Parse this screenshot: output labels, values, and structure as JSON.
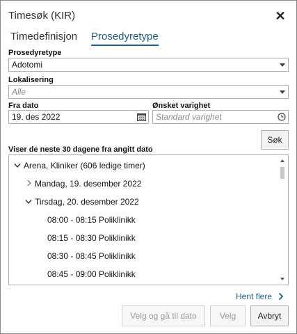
{
  "dialog": {
    "title": "Timesøk (KIR)",
    "close_glyph": "✕"
  },
  "tabs": [
    {
      "label": "Timedefinisjon",
      "active": false
    },
    {
      "label": "Prosedyretype",
      "active": true
    }
  ],
  "form": {
    "procedure_type": {
      "label": "Prosedyretype",
      "value": "Adotomi"
    },
    "location": {
      "label": "Lokalisering",
      "placeholder": "Alle"
    },
    "from_date": {
      "label": "Fra dato",
      "value": "19. des 2022"
    },
    "duration": {
      "label": "Ønsket varighet",
      "placeholder": "Standard varighet"
    },
    "search_label": "Søk"
  },
  "results": {
    "heading": "Viser de neste 30 dagene fra angitt dato",
    "group": "Arena, Kliniker (606 ledige timer)",
    "days": [
      {
        "label": "Mandag, 19. desember 2022",
        "expanded": false
      },
      {
        "label": "Tirsdag, 20. desember 2022",
        "expanded": true
      }
    ],
    "slots": [
      "08:00 - 08:15 Poliklinikk",
      "08:15 - 08:30 Poliklinikk",
      "08:30 - 08:45 Poliklinikk",
      "08:45 - 09:00 Poliklinikk"
    ]
  },
  "footer": {
    "more_label": "Hent flere",
    "select_go_label": "Velg og gå til dato",
    "select_label": "Velg",
    "cancel_label": "Avbryt"
  },
  "colors": {
    "accent": "#1b5e87",
    "border": "#adadad"
  }
}
